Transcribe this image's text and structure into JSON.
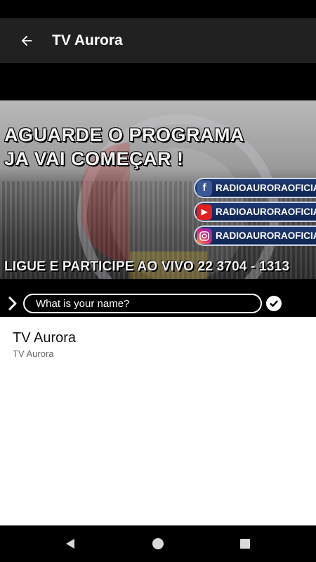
{
  "app_bar": {
    "title": "TV Aurora",
    "back_icon": "arrow-left-icon"
  },
  "video": {
    "promo_headline": [
      "AGUARDE O PROGRAMA",
      "JA VAI COMEÇAR !"
    ],
    "social": [
      {
        "icon": "facebook-icon",
        "handle": "RADIOAURORAOFICIAL"
      },
      {
        "icon": "youtube-icon",
        "handle": "RADIOAURORAOFICIAL"
      },
      {
        "icon": "instagram-icon",
        "handle": "RADIOAURORAOFICIAL_"
      }
    ],
    "call_line": "LIGUE E PARTICIPE AO VIVO 22 3704 - 1313"
  },
  "name_bar": {
    "placeholder": "What is your name?",
    "value": "",
    "chevron_icon": "chevron-right-icon",
    "submit_icon": "check-circle-icon"
  },
  "info": {
    "title": "TV Aurora",
    "subtitle": "TV Aurora"
  },
  "colors": {
    "app_bar": "#212121",
    "status_bar": "#000000",
    "nav_bar": "#000000",
    "video_background": "#000000"
  },
  "nav": {
    "back_icon": "triangle-back-icon",
    "home_icon": "circle-home-icon",
    "recents_icon": "square-recents-icon"
  }
}
